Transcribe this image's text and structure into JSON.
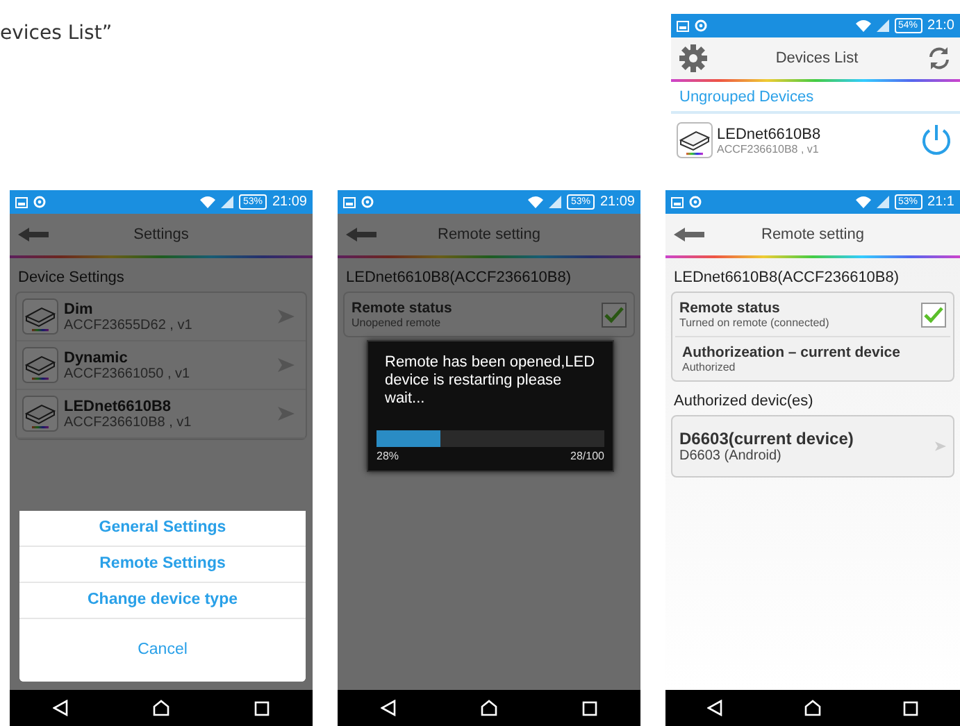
{
  "caption": "evices List”",
  "devices_list_screen": {
    "status_bar": {
      "battery": "54%",
      "time": "21:0"
    },
    "title": "Devices List",
    "section": "Ungrouped Devices",
    "devices": [
      {
        "name": "LEDnet6610B8",
        "id": "ACCF236610B8 , v1"
      }
    ]
  },
  "settings_screen": {
    "status_bar": {
      "battery": "53%",
      "time": "21:09"
    },
    "title": "Settings",
    "section": "Device Settings",
    "devices": [
      {
        "name": "Dim",
        "id": "ACCF23655D62 , v1"
      },
      {
        "name": "Dynamic",
        "id": "ACCF23661050 , v1"
      },
      {
        "name": "LEDnet6610B8",
        "id": "ACCF236610B8 , v1"
      }
    ],
    "dialog": {
      "options": [
        "General Settings",
        "Remote Settings",
        "Change device type"
      ],
      "cancel": "Cancel"
    }
  },
  "remote_screen": {
    "status_bar": {
      "battery": "53%",
      "time": "21:09"
    },
    "title": "Remote setting",
    "device": "LEDnet6610B8(ACCF236610B8)",
    "items": [
      {
        "kind": "checkbox",
        "title": "Remote status",
        "subtitle": "Unopened remote",
        "checked": true
      }
    ],
    "progress": {
      "message": "Remote has been opened,LED device is restarting please wait...",
      "level": 0.28,
      "percent": "28%",
      "count": "28/100"
    }
  },
  "remote_screen_connected": {
    "status_bar": {
      "battery": "53%",
      "time": "21:1"
    },
    "title": "Remote setting",
    "device": "LEDnet6610B8(ACCF236610B8)",
    "items": [
      {
        "kind": "checkbox",
        "title": "Remote status",
        "subtitle": "Turned on remote (connected)",
        "checked": true
      },
      {
        "kind": "plain",
        "title": "Authorizeation – current device",
        "subtitle": "Authorized"
      }
    ],
    "section": "Authorized devic(es)",
    "authorized": [
      {
        "name": "D6603(current device)",
        "detail": "D6603 (Android)"
      }
    ]
  }
}
